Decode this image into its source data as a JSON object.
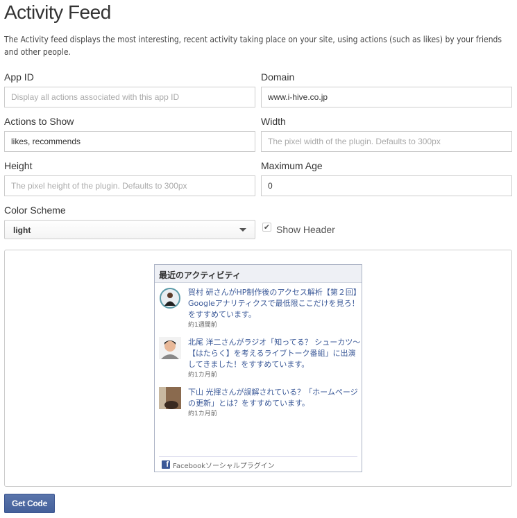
{
  "title": "Activity Feed",
  "description": "The Activity feed displays the most interesting, recent activity taking place on your site, using actions (such as likes) by your friends and other people.",
  "fields": {
    "app_id": {
      "label": "App ID",
      "value": "",
      "placeholder": "Display all actions associated with this app ID"
    },
    "domain": {
      "label": "Domain",
      "value": "www.i-hive.co.jp",
      "placeholder": ""
    },
    "actions": {
      "label": "Actions to Show",
      "value": "likes, recommends",
      "placeholder": ""
    },
    "width": {
      "label": "Width",
      "value": "",
      "placeholder": "The pixel width of the plugin. Defaults to 300px"
    },
    "height": {
      "label": "Height",
      "value": "",
      "placeholder": "The pixel height of the plugin. Defaults to 300px"
    },
    "max_age": {
      "label": "Maximum Age",
      "value": "0",
      "placeholder": ""
    },
    "color_scheme": {
      "label": "Color Scheme",
      "value": "light"
    },
    "show_header": {
      "label": "Show Header",
      "checked": true
    }
  },
  "plugin": {
    "header": "最近のアクティビティ",
    "items": [
      {
        "text": "賀村 研さんがHP制作後のアクセス解析【第２回】Googleアナリティクスで最低限ここだけを見ろ！をすすめています。",
        "time": "約1週間前"
      },
      {
        "text": "北尾 洋二さんがラジオ「知ってる？ シューカツ～【はたらく】を考えるライブトーク番組」に出演してきました！をすすめています。",
        "time": "約1カ月前"
      },
      {
        "text": "下山 光揮さんが誤解されている？「ホームページの更新」とは？をすすめています。",
        "time": "約1カ月前"
      }
    ],
    "footer": "Facebookソーシャルプラグイン"
  },
  "get_code_label": "Get Code",
  "colors": {
    "accent": "#4a66a0",
    "facebook": "#3b5998"
  }
}
